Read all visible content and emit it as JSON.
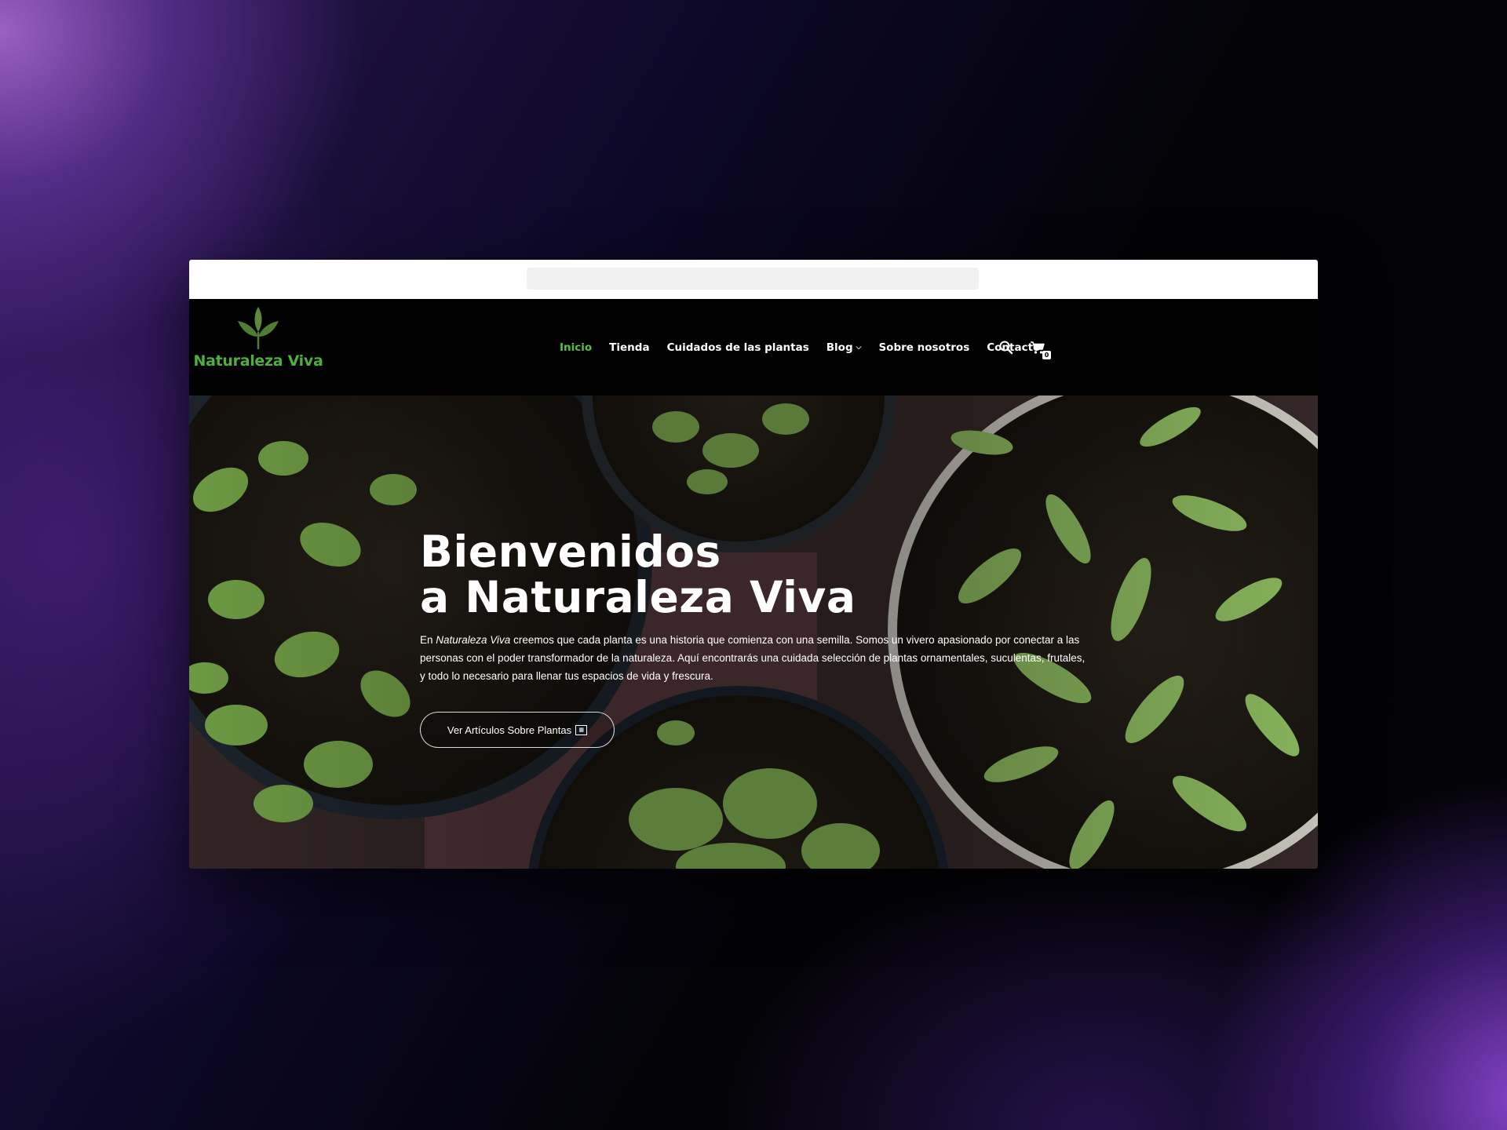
{
  "header": {
    "logo_text": "Naturaleza Viva",
    "nav": [
      {
        "label": "Inicio",
        "active": true
      },
      {
        "label": "Tienda"
      },
      {
        "label": "Cuidados de las plantas"
      },
      {
        "label": "Blog",
        "has_dropdown": true
      },
      {
        "label": "Sobre nosotros"
      },
      {
        "label": "Contacto"
      }
    ],
    "cart_count": "0",
    "icons": [
      "search-icon",
      "cart-icon"
    ]
  },
  "hero": {
    "title_line1": "Bienvenidos",
    "title_line2": "a Naturaleza Viva",
    "text_prefix": "En ",
    "text_brand": "Naturaleza Viva",
    "text_body": " creemos que cada planta es una historia que comienza con una semilla. Somos un vivero apasionado por conectar a las personas con el poder transformador de la naturaleza. Aquí encontrarás una cuidada selección de plantas ornamentales, suculentas, frutales, y todo lo necesario para llenar tus espacios de vida y frescura.",
    "cta_label": "Ver Artículos Sobre Plantas"
  },
  "colors": {
    "accent_green": "#58c043",
    "logo_green": "#4fae3e",
    "header_bg": "#000000"
  }
}
